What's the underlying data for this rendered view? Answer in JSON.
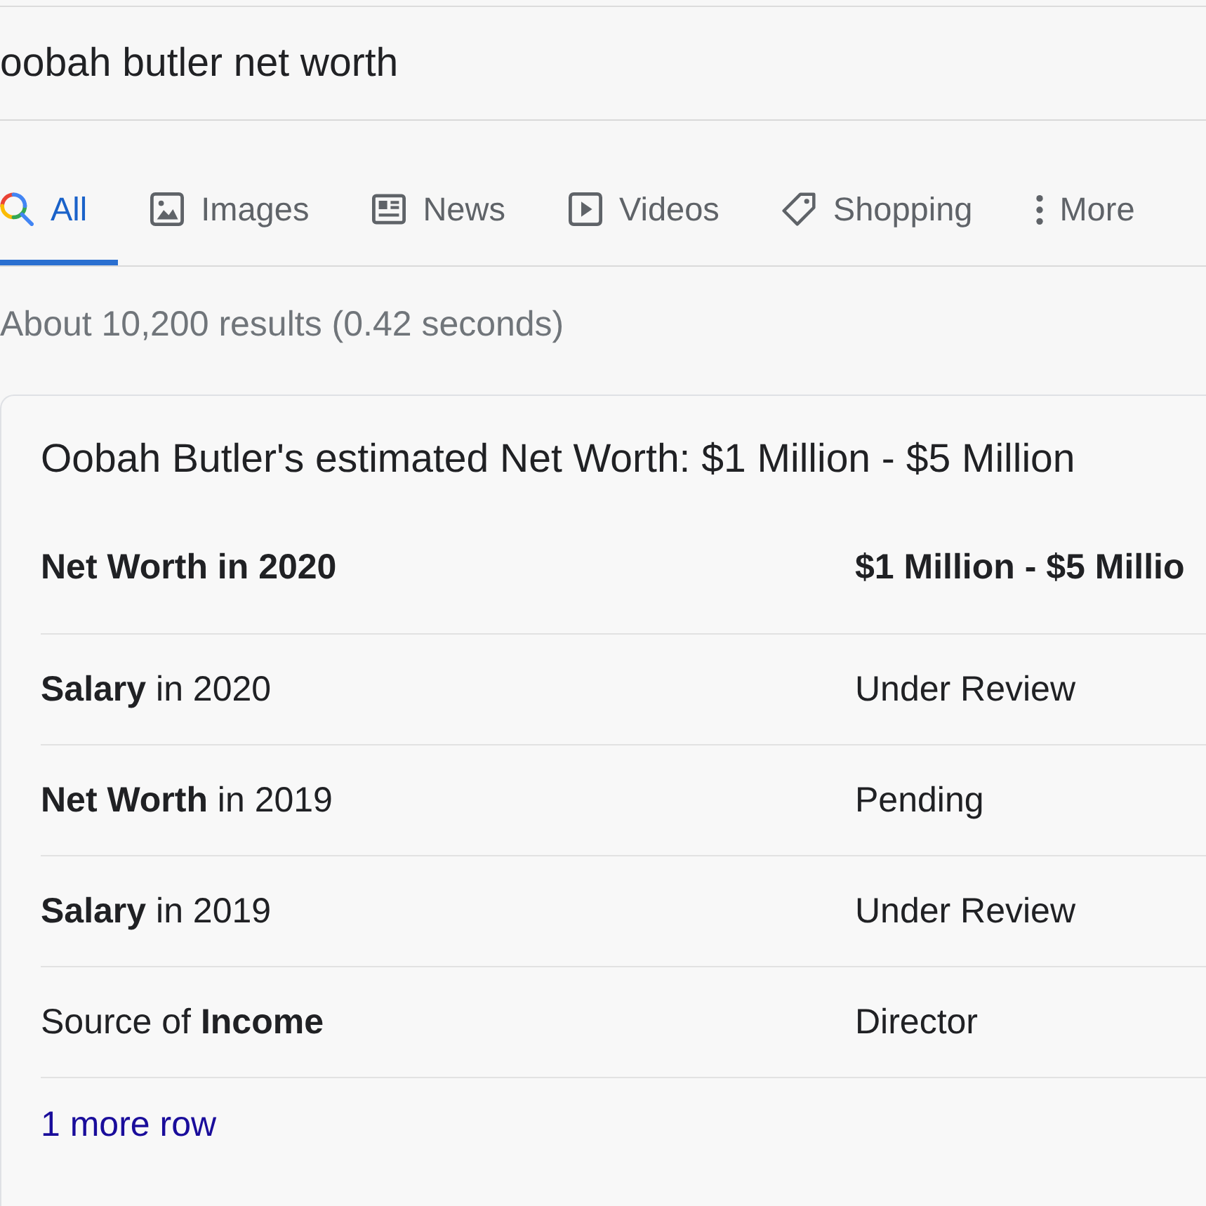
{
  "search": {
    "value": "oobah butler net worth"
  },
  "tabs": [
    {
      "kind": "all",
      "label": "All",
      "selected": true
    },
    {
      "kind": "images",
      "label": "Images",
      "selected": false
    },
    {
      "kind": "news",
      "label": "News",
      "selected": false
    },
    {
      "kind": "videos",
      "label": "Videos",
      "selected": false
    },
    {
      "kind": "shopping",
      "label": "Shopping",
      "selected": false
    },
    {
      "kind": "more",
      "label": "More",
      "selected": false
    }
  ],
  "result_stats": "About 10,200 results (0.42 seconds)",
  "answer_card": {
    "title": "Oobah Butler's estimated Net Worth: $1 Million - $5 Million",
    "rows": [
      {
        "kind": "headline",
        "label": "Net Worth in 2020",
        "value": "$1 Million - $5 Millio"
      },
      {
        "kind": "plain",
        "label": "**Salary** in 2020",
        "value": "Under Review"
      },
      {
        "kind": "plain",
        "label": "**Net Worth** in 2019",
        "value": "Pending"
      },
      {
        "kind": "plain",
        "label": "**Salary** in 2019",
        "value": "Under Review"
      },
      {
        "kind": "plain",
        "label": "Source of **Income**",
        "value": "Director"
      }
    ],
    "more_link": "1 more row"
  }
}
